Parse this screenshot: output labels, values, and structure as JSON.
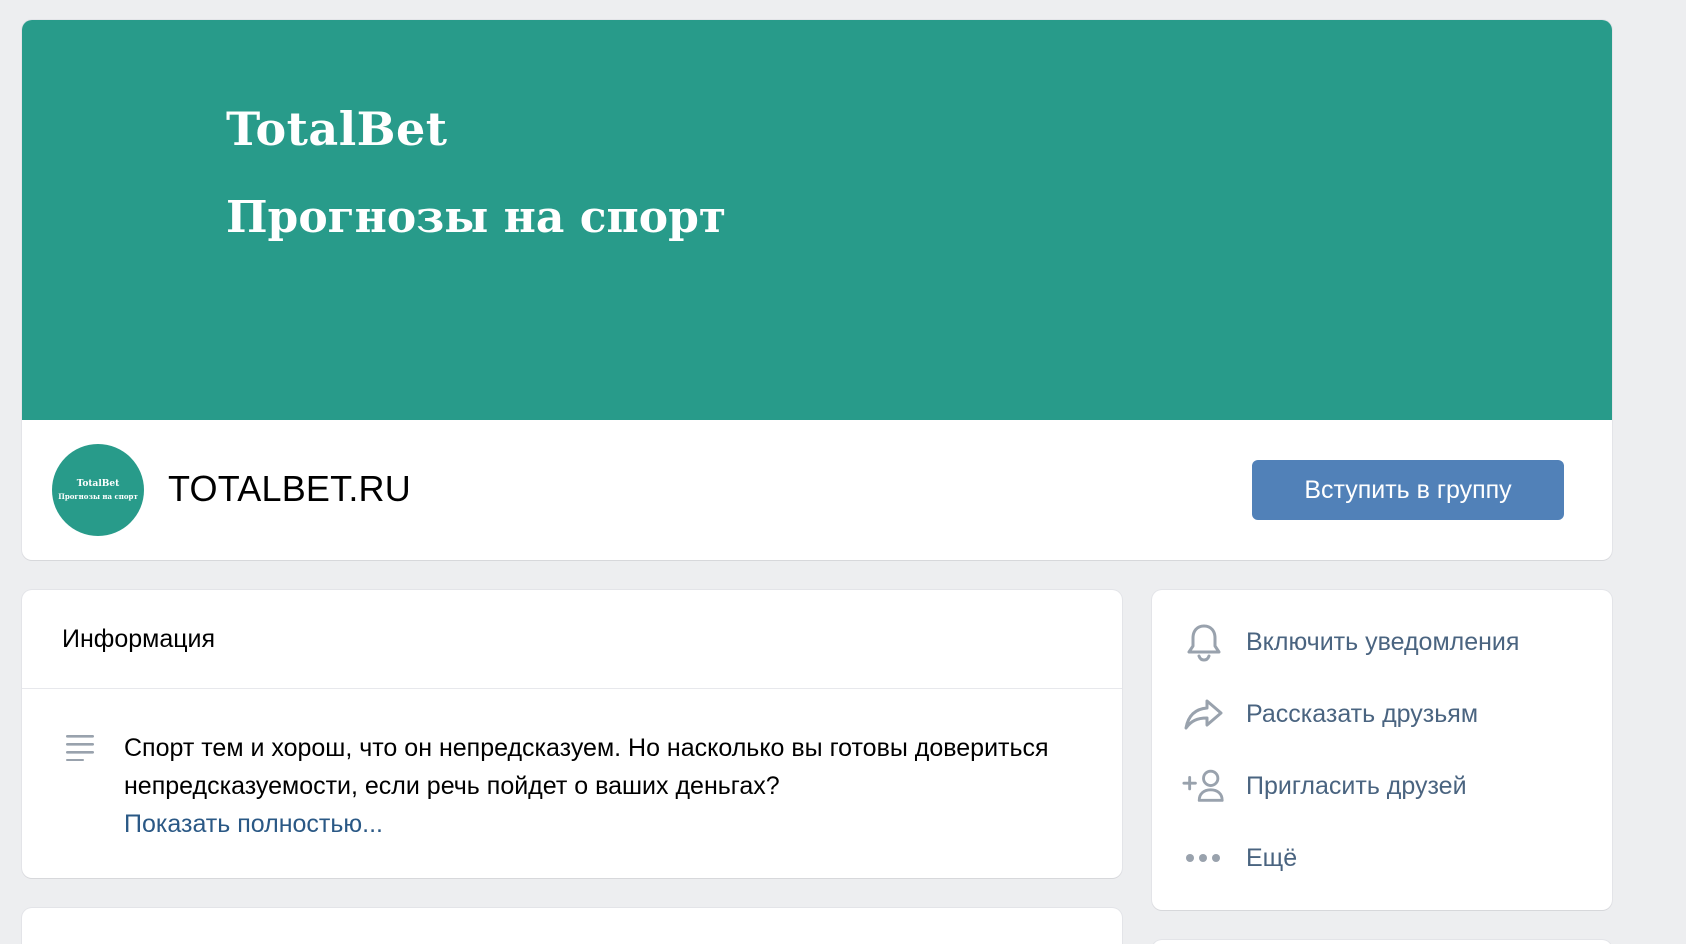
{
  "cover": {
    "title": "TotalBet",
    "subtitle": "Прогнозы на спорт"
  },
  "avatar": {
    "title": "TotalBet",
    "subtitle": "Прогнозы на спорт"
  },
  "group": {
    "name": "TOTALBET.RU",
    "join_label": "Вступить в группу"
  },
  "info": {
    "header": "Информация",
    "text": "Спорт тем и хорош, что он непредсказуем. Но насколько вы готовы довериться непредсказуемости, если речь пойдет о ваших деньгах?",
    "show_more": "Показать полностью..."
  },
  "actions": {
    "items": [
      {
        "label": "Включить уведомления",
        "icon": "bell-icon"
      },
      {
        "label": "Рассказать друзьям",
        "icon": "share-icon"
      },
      {
        "label": "Пригласить друзей",
        "icon": "add-user-icon"
      },
      {
        "label": "Ещё",
        "icon": "more-icon"
      }
    ]
  },
  "colors": {
    "cover": "#289b8a",
    "button": "#5181b8",
    "link": "#2a5885",
    "background": "#edeef0"
  }
}
